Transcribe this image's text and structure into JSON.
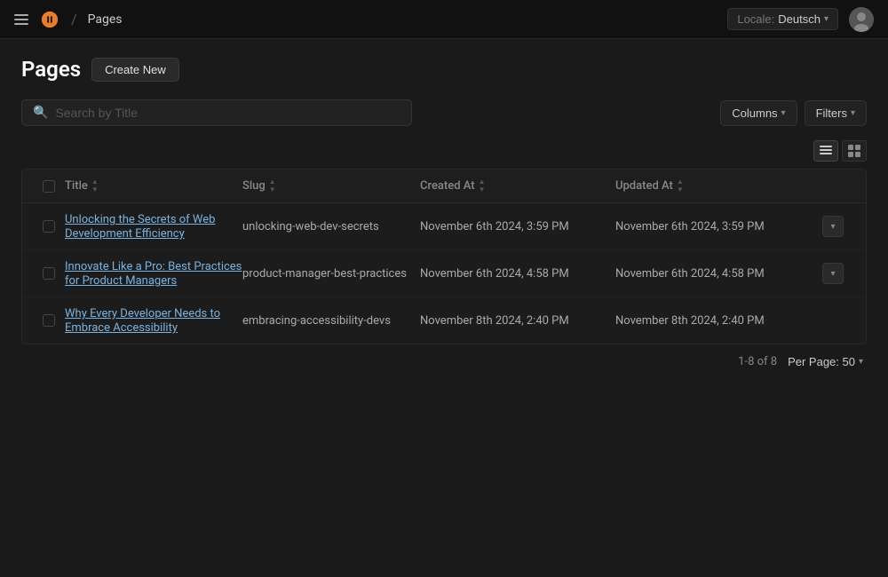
{
  "topbar": {
    "breadcrumb_sep": "/",
    "breadcrumb_label": "Pages",
    "locale_prefix": "Locale:",
    "locale_value": "Deutsch"
  },
  "page": {
    "title": "Pages",
    "create_btn_label": "Create New"
  },
  "search": {
    "placeholder": "Search by Title"
  },
  "toolbar": {
    "columns_label": "Columns",
    "filters_label": "Filters"
  },
  "table": {
    "columns": [
      {
        "id": "title",
        "label": "Title"
      },
      {
        "id": "slug",
        "label": "Slug"
      },
      {
        "id": "created_at",
        "label": "Created At"
      },
      {
        "id": "updated_at",
        "label": "Updated At"
      }
    ],
    "rows": [
      {
        "id": 1,
        "title": "Unlocking the Secrets of Web Development Efficiency",
        "slug": "unlocking-web-dev-secrets",
        "created_at": "November 6th 2024, 3:59 PM",
        "updated_at": "November 6th 2024, 3:59 PM"
      },
      {
        "id": 2,
        "title": "Innovate Like a Pro: Best Practices for Product Managers",
        "slug": "product-manager-best-practices",
        "created_at": "November 6th 2024, 4:58 PM",
        "updated_at": "November 6th 2024, 4:58 PM"
      },
      {
        "id": 3,
        "title": "Why Every Developer Needs to Embrace Accessibility",
        "slug": "embracing-accessibility-devs",
        "created_at": "November 8th 2024, 2:40 PM",
        "updated_at": "November 8th 2024, 2:40 PM"
      }
    ]
  },
  "pagination": {
    "range": "1-8 of 8",
    "per_page_label": "Per Page: 50"
  }
}
